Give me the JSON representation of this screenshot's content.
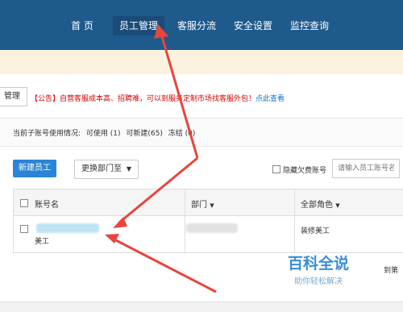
{
  "nav": {
    "items": [
      {
        "label": "首 页"
      },
      {
        "label": "员工管理"
      },
      {
        "label": "客服分流"
      },
      {
        "label": "安全设置"
      },
      {
        "label": "监控查询"
      }
    ]
  },
  "toolbar": {
    "manage_label": "管理"
  },
  "announcement": {
    "tag": "【公告】",
    "message": "自营客服成本高、招聘难，可以到服务定制市场找客服外包！",
    "link": "点此查看"
  },
  "usage": {
    "label": "当前子账号使用情况:",
    "used": "可使用 (1)",
    "new": "可新建(65)",
    "frozen": "冻结 (0)"
  },
  "actions": {
    "new_employee": "新建员工",
    "change_dept": "更换部门至",
    "hide_overdue": "隐藏欠费账号",
    "search_placeholder": "请输入员工账号名"
  },
  "table": {
    "headers": {
      "account": "账号名",
      "dept": "部门",
      "role": "全部角色"
    },
    "rows": [
      {
        "account_tail": "美工",
        "role": "装修美工"
      }
    ]
  },
  "watermark": {
    "title": "百科全说",
    "subtitle": "助你轻松解决"
  },
  "page_tail": "到第",
  "colors": {
    "nav_bg": "#1f5a8c",
    "primary_button": "#2b85d6",
    "alert": "#d20000",
    "link": "#1a73c7",
    "arrow": "#e8453c"
  }
}
